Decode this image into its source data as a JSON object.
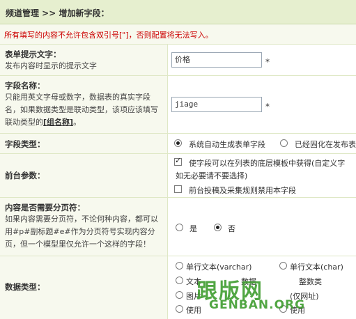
{
  "header": {
    "breadcrumb": "频道管理 >> 增加新字段："
  },
  "notice": "所有填写的内容不允许包含双引号[\"]，否则配置将无法写入。",
  "form_label": {
    "label": "表单提示文字：",
    "desc": "发布内容时显示的提示文字",
    "value": "价格"
  },
  "field_name": {
    "label": "字段名称：",
    "desc_part1": "只能用英文字母或数字，数据表的真实字段名，如果数据类型是联动类型，该项应该填写联动类型的",
    "link": "[组名称]",
    "desc_part2": "。",
    "value": "jiage"
  },
  "required_mark": "*",
  "field_type": {
    "label": "字段类型：",
    "options": [
      "系统自动生成表单字段",
      "已经固化在发布表"
    ]
  },
  "frontend": {
    "label": "前台参数：",
    "opt1": "使字段可以在列表的底层模板中获得(自定义字",
    "opt1_note": "如无必要请不要选择)",
    "opt2": "前台投稿及采集规则禁用本字段"
  },
  "paging": {
    "label": "内容是否需要分页符：",
    "desc": "如果内容需要分页符，不论何种内容，都可以用#p#副标题#e#作为分页符号实现内容分页，但一个模型里仅允许一个这样的字段！",
    "options": [
      "是",
      "否"
    ]
  },
  "data_type": {
    "label": "数据类型：",
    "options": [
      "单行文本(varchar)",
      "单行文本(char)",
      "文本",
      "数据",
      "整数类",
      "图片",
      "(仅网址)",
      "使用",
      "使用"
    ]
  },
  "watermark": {
    "cn": "跟版网",
    "en": "GENBAN.ORG"
  }
}
